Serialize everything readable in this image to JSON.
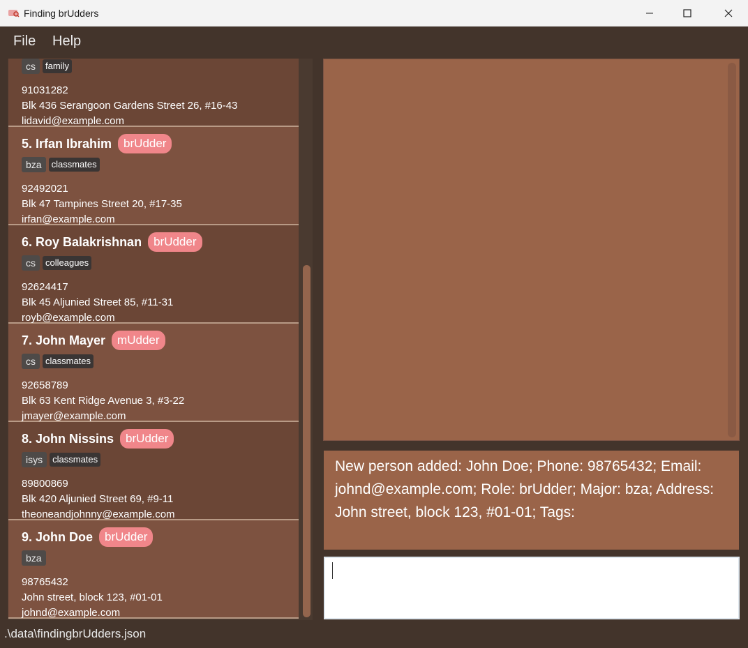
{
  "window": {
    "title": "Finding brUdders"
  },
  "menu": {
    "file": "File",
    "help": "Help"
  },
  "persons": [
    {
      "name": "",
      "role": "",
      "major": "cs",
      "tags": [
        "family"
      ],
      "phone": "91031282",
      "address": "Blk 436 Serangoon Gardens Street 26, #16-43",
      "email": "lidavid@example.com"
    },
    {
      "name": "5. Irfan Ibrahim",
      "role": "brUdder",
      "major": "bza",
      "tags": [
        "classmates"
      ],
      "phone": "92492021",
      "address": "Blk 47 Tampines Street 20, #17-35",
      "email": "irfan@example.com"
    },
    {
      "name": "6. Roy Balakrishnan",
      "role": "brUdder",
      "major": "cs",
      "tags": [
        "colleagues"
      ],
      "phone": "92624417",
      "address": "Blk 45 Aljunied Street 85, #11-31",
      "email": "royb@example.com"
    },
    {
      "name": "7. John Mayer",
      "role": "mUdder",
      "major": "cs",
      "tags": [
        "classmates"
      ],
      "phone": "92658789",
      "address": "Blk 63 Kent Ridge Avenue 3, #3-22",
      "email": "jmayer@example.com"
    },
    {
      "name": "8. John Nissins",
      "role": "brUdder",
      "major": "isys",
      "tags": [
        "classmates"
      ],
      "phone": "89800869",
      "address": "Blk 420 Aljunied Street 69, #9-11",
      "email": "theoneandjohnny@example.com"
    },
    {
      "name": "9. John Doe",
      "role": "brUdder",
      "major": "bza",
      "tags": [],
      "phone": "98765432",
      "address": "John street, block 123, #01-01",
      "email": "johnd@example.com"
    }
  ],
  "feedback": {
    "text": "New person added: John Doe; Phone: 98765432; Email: johnd@example.com; Role: brUdder; Major: bza; Address: John street, block 123, #01-01; Tags:"
  },
  "command": {
    "value": ""
  },
  "status": {
    "path": ".\\data\\findingbrUdders.json"
  },
  "colors": {
    "background": "#43342b",
    "card_a": "#6b4636",
    "card_b": "#7d5240",
    "badge": "#f0868a",
    "panel": "#9a6449"
  },
  "icons": {
    "app": "app-logo-icon",
    "minimize": "minimize-icon",
    "maximize": "maximize-icon",
    "close": "close-icon"
  }
}
